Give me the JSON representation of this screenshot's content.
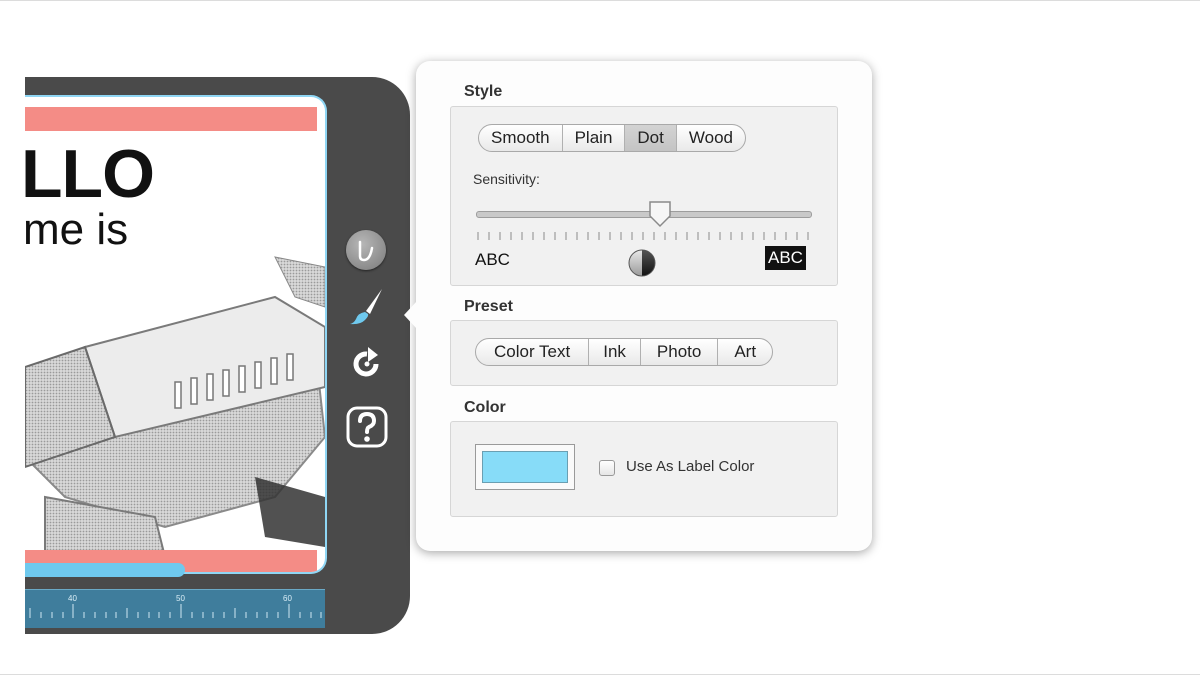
{
  "label_preview": {
    "headline": "LLO",
    "subline": "me is",
    "ruler_numbers": [
      "40",
      "50",
      "60"
    ]
  },
  "tools": [
    {
      "name": "stroke-style-tool",
      "icon": "stroke-icon"
    },
    {
      "name": "brush-tool",
      "icon": "paintbrush-icon"
    },
    {
      "name": "rotate-tool",
      "icon": "rotate-icon"
    },
    {
      "name": "help-tool",
      "icon": "question-icon"
    }
  ],
  "popover": {
    "style": {
      "title": "Style",
      "options": [
        "Smooth",
        "Plain",
        "Dot",
        "Wood"
      ],
      "selected": "Dot",
      "sensitivity_label": "Sensitivity:",
      "sensitivity_value": 0.55,
      "light_sample": "ABC",
      "dark_sample": "ABC"
    },
    "preset": {
      "title": "Preset",
      "options": [
        "Color Text",
        "Ink",
        "Photo",
        "Art"
      ]
    },
    "color": {
      "title": "Color",
      "swatch": "#87dcf8",
      "use_as_label_color": "Use As Label Color",
      "checked": false
    }
  },
  "colors": {
    "panel_bg": "#4a4a4a",
    "label_pink": "#f48c86",
    "accent_blue": "#6fc9ee"
  }
}
